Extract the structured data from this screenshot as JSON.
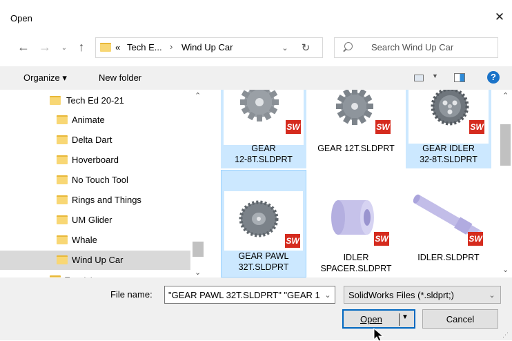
{
  "window": {
    "title": "Open",
    "close_glyph": "✕"
  },
  "address": {
    "prefix": "«",
    "crumbs": [
      "Tech E...",
      "Wind Up Car"
    ],
    "separator": "›"
  },
  "search": {
    "placeholder": "Search Wind Up Car"
  },
  "toolbar": {
    "organize_label": "Organize ▾",
    "new_folder_label": "New folder"
  },
  "tree": {
    "items": [
      {
        "label": "Tech Ed 20-21"
      },
      {
        "label": "Animate"
      },
      {
        "label": "Delta Dart"
      },
      {
        "label": "Hoverboard"
      },
      {
        "label": "No Touch Tool"
      },
      {
        "label": "Rings and Things"
      },
      {
        "label": "UM Glider"
      },
      {
        "label": "Whale"
      },
      {
        "label": "Wind Up Car"
      },
      {
        "label": "Tutorials"
      }
    ],
    "selected": "Wind Up Car"
  },
  "files": [
    {
      "line1": "GEAR",
      "line2": "12-8T.SLDPRT",
      "selected": true,
      "icon": "gear-part-icon",
      "badge": "SW"
    },
    {
      "line1": "GEAR 12T.SLDPRT",
      "line2": "",
      "selected": false,
      "icon": "gear-part-icon",
      "badge": "SW"
    },
    {
      "line1": "GEAR IDLER",
      "line2": "32-8T.SLDPRT",
      "selected": true,
      "icon": "gear-part-icon",
      "badge": "SW"
    },
    {
      "line1": "GEAR PAWL",
      "line2": "32T.SLDPRT",
      "selected": true,
      "icon": "gear-part-icon",
      "badge": "SW"
    },
    {
      "line1": "IDLER",
      "line2": "SPACER.SLDPRT",
      "selected": false,
      "icon": "spacer-part-icon",
      "badge": "SW"
    },
    {
      "line1": "IDLER.SLDPRT",
      "line2": "",
      "selected": false,
      "icon": "shaft-part-icon",
      "badge": "SW"
    }
  ],
  "footer": {
    "filename_label": "File name:",
    "filename_value": "\"GEAR PAWL 32T.SLDPRT\" \"GEAR 1",
    "filetype_value": "SolidWorks Files (*.sldprt;)",
    "open_label": "Open",
    "cancel_label": "Cancel"
  },
  "colors": {
    "selection": "#cce8ff",
    "folder": "#f8d775",
    "sw_badge": "#d52b1e",
    "accent": "#0067c0"
  }
}
